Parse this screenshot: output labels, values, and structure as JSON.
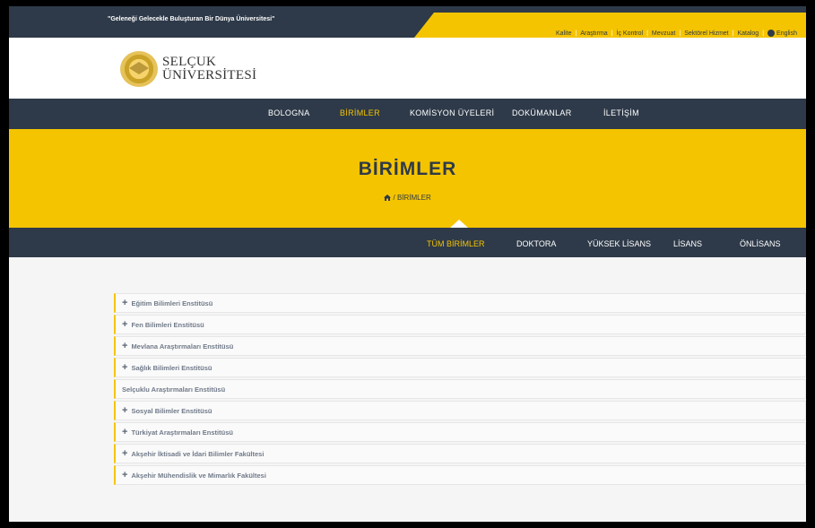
{
  "topbar": {
    "slogan": "\"Geleneği Gelecekle Buluşturan Bir Dünya Üniversitesi\"",
    "links": [
      "Kalite",
      "Araştırma",
      "İç Kontrol",
      "Mevzuat",
      "Sektörel Hizmet",
      "Katalog",
      "English"
    ]
  },
  "logo": {
    "line1": "SELÇUK",
    "line2": "ÜNİVERSİTESİ"
  },
  "nav": {
    "items": [
      "BOLOGNA",
      "BİRİMLER",
      "KOMİSYON ÜYELERİ",
      "DOKÜMANLAR",
      "İLETİŞİM"
    ],
    "active": "BİRİMLER"
  },
  "banner": {
    "title": "BİRİMLER",
    "home_icon": "home-icon",
    "breadcrumb": "/  BİRİMLER"
  },
  "subnav": {
    "items": [
      "TÜM BİRİMLER",
      "DOKTORA",
      "YÜKSEK LİSANS",
      "LİSANS",
      "ÖNLİSANS"
    ],
    "active": "TÜM BİRİMLER"
  },
  "units": [
    {
      "label": "Eğitim Bilimleri Enstitüsü",
      "expandable": true
    },
    {
      "label": "Fen Bilimleri Enstitüsü",
      "expandable": true
    },
    {
      "label": "Mevlana Araştırmaları Enstitüsü",
      "expandable": true
    },
    {
      "label": "Sağlık Bilimleri Enstitüsü",
      "expandable": true
    },
    {
      "label": "Selçuklu Araştırmaları Enstitüsü",
      "expandable": false
    },
    {
      "label": "Sosyal Bilimler Enstitüsü",
      "expandable": true
    },
    {
      "label": "Türkiyat Araştırmaları Enstitüsü",
      "expandable": true
    },
    {
      "label": "Akşehir İktisadi ve İdari Bilimler Fakültesi",
      "expandable": true
    },
    {
      "label": "Akşehir Mühendislik ve Mimarlık Fakültesi",
      "expandable": true
    }
  ],
  "colors": {
    "navy": "#2e3a49",
    "yellow": "#f5c400"
  }
}
